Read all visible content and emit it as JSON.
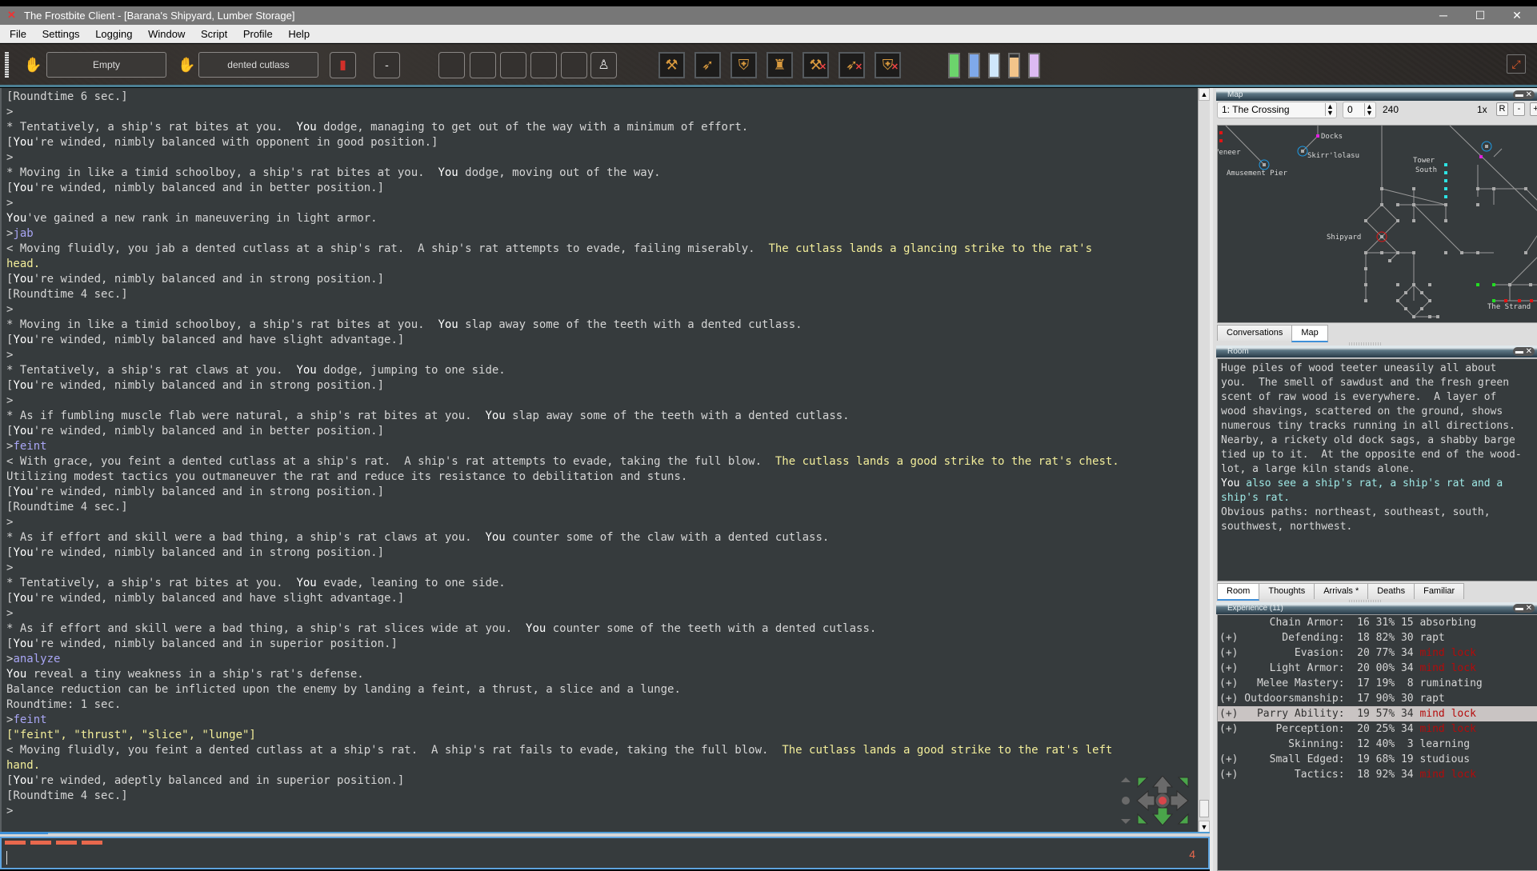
{
  "window": {
    "title": "The Frostbite Client - [Barana's Shipyard, Lumber Storage]",
    "app_icon": "frostbite-x-icon",
    "controls": {
      "minimize": "─",
      "maximize": "☐",
      "close": "✕"
    }
  },
  "menu": [
    "File",
    "Settings",
    "Logging",
    "Window",
    "Script",
    "Profile",
    "Help"
  ],
  "toolbar": {
    "left_hand_icon": "hand-icon",
    "left_hand": "Empty",
    "right_hand_icon": "hand-icon",
    "right_hand": "dented cutlass",
    "spell_icon": "spellbook-icon",
    "spell": "-",
    "status_slots": [
      "",
      "",
      "",
      "",
      ""
    ],
    "stance_icon": "standing-figure-icon",
    "wield_icons": [
      {
        "name": "melee-weapon-icon",
        "glyph": "⚒",
        "crossed": false
      },
      {
        "name": "bow-icon",
        "glyph": "➶",
        "crossed": false
      },
      {
        "name": "shield-icon",
        "glyph": "⛨",
        "crossed": false
      },
      {
        "name": "armor-icon",
        "glyph": "♜",
        "crossed": false
      },
      {
        "name": "melee-weapon-icon",
        "glyph": "⚒",
        "crossed": true
      },
      {
        "name": "bow-icon",
        "glyph": "➶",
        "crossed": true
      },
      {
        "name": "shield-icon",
        "glyph": "⛨",
        "crossed": true
      }
    ],
    "vitals": [
      {
        "name": "health",
        "color": "#6cd46c",
        "value": 100
      },
      {
        "name": "mana",
        "color": "#7fa9ea",
        "value": 100
      },
      {
        "name": "concentration",
        "color": "#cfe7fb",
        "value": 100
      },
      {
        "name": "fatigue",
        "color": "#f2c48a",
        "value": 85
      },
      {
        "name": "spirit",
        "color": "#dcbaf2",
        "value": 100
      }
    ],
    "fullscreen_icon": "⤢"
  },
  "game_log": [
    [
      {
        "t": "[Roundtime 6 sec.]"
      }
    ],
    [
      {
        "t": ">"
      }
    ],
    [
      {
        "t": "* Tentatively, a ship's rat bites at you.  "
      },
      {
        "t": "You",
        "c": "you"
      },
      {
        "t": " dodge, managing to get out of the way with a minimum of effort."
      }
    ],
    [
      {
        "t": "["
      },
      {
        "t": "You",
        "c": "you"
      },
      {
        "t": "'re winded, nimbly balanced with opponent in good position.]"
      }
    ],
    [
      {
        "t": ">"
      }
    ],
    [
      {
        "t": "* Moving in like a timid schoolboy, a ship's rat bites at you.  "
      },
      {
        "t": "You",
        "c": "you"
      },
      {
        "t": " dodge, moving out of the way."
      }
    ],
    [
      {
        "t": "["
      },
      {
        "t": "You",
        "c": "you"
      },
      {
        "t": "'re winded, nimbly balanced and in better position.]"
      }
    ],
    [
      {
        "t": ">"
      }
    ],
    [
      {
        "t": "You",
        "c": "you"
      },
      {
        "t": "'ve gained a new rank in maneuvering in light armor."
      }
    ],
    [
      {
        "t": ">"
      },
      {
        "t": "jab",
        "c": "cmd"
      }
    ],
    [
      {
        "t": "< Moving fluidly, you jab a dented cutlass at a ship's rat.  A ship's rat attempts to evade, failing miserably.  "
      },
      {
        "t": "The cutlass lands a glancing strike to the rat's",
        "c": "strike"
      }
    ],
    [
      {
        "t": "head.",
        "c": "strike"
      }
    ],
    [
      {
        "t": "["
      },
      {
        "t": "You",
        "c": "you"
      },
      {
        "t": "'re winded, nimbly balanced and in strong position.]"
      }
    ],
    [
      {
        "t": "[Roundtime 4 sec.]"
      }
    ],
    [
      {
        "t": ">"
      }
    ],
    [
      {
        "t": "* Moving in like a timid schoolboy, a ship's rat bites at you.  "
      },
      {
        "t": "You",
        "c": "you"
      },
      {
        "t": " slap away some of the teeth with a dented cutlass."
      }
    ],
    [
      {
        "t": "["
      },
      {
        "t": "You",
        "c": "you"
      },
      {
        "t": "'re winded, nimbly balanced and have slight advantage.]"
      }
    ],
    [
      {
        "t": ">"
      }
    ],
    [
      {
        "t": "* Tentatively, a ship's rat claws at you.  "
      },
      {
        "t": "You",
        "c": "you"
      },
      {
        "t": " dodge, jumping to one side."
      }
    ],
    [
      {
        "t": "["
      },
      {
        "t": "You",
        "c": "you"
      },
      {
        "t": "'re winded, nimbly balanced and in strong position.]"
      }
    ],
    [
      {
        "t": ">"
      }
    ],
    [
      {
        "t": "* As if fumbling muscle flab were natural, a ship's rat bites at you.  "
      },
      {
        "t": "You",
        "c": "you"
      },
      {
        "t": " slap away some of the teeth with a dented cutlass."
      }
    ],
    [
      {
        "t": "["
      },
      {
        "t": "You",
        "c": "you"
      },
      {
        "t": "'re winded, nimbly balanced and in better position.]"
      }
    ],
    [
      {
        "t": ">"
      },
      {
        "t": "feint",
        "c": "cmd"
      }
    ],
    [
      {
        "t": "< With grace, you feint a dented cutlass at a ship's rat.  A ship's rat attempts to evade, taking the full blow.  "
      },
      {
        "t": "The cutlass lands a good strike to the rat's chest.",
        "c": "strike"
      }
    ],
    [
      {
        "t": "Utilizing modest tactics you outmaneuver the rat and reduce its resistance to debilitation and stuns."
      }
    ],
    [
      {
        "t": "["
      },
      {
        "t": "You",
        "c": "you"
      },
      {
        "t": "'re winded, nimbly balanced and in strong position.]"
      }
    ],
    [
      {
        "t": "[Roundtime 4 sec.]"
      }
    ],
    [
      {
        "t": ">"
      }
    ],
    [
      {
        "t": "* As if effort and skill were a bad thing, a ship's rat claws at you.  "
      },
      {
        "t": "You",
        "c": "you"
      },
      {
        "t": " counter some of the claw with a dented cutlass."
      }
    ],
    [
      {
        "t": "["
      },
      {
        "t": "You",
        "c": "you"
      },
      {
        "t": "'re winded, nimbly balanced and in strong position.]"
      }
    ],
    [
      {
        "t": ">"
      }
    ],
    [
      {
        "t": "* Tentatively, a ship's rat bites at you.  "
      },
      {
        "t": "You",
        "c": "you"
      },
      {
        "t": " evade, leaning to one side."
      }
    ],
    [
      {
        "t": "["
      },
      {
        "t": "You",
        "c": "you"
      },
      {
        "t": "'re winded, nimbly balanced and have slight advantage.]"
      }
    ],
    [
      {
        "t": ">"
      }
    ],
    [
      {
        "t": "* As if effort and skill were a bad thing, a ship's rat slices wide at you.  "
      },
      {
        "t": "You",
        "c": "you"
      },
      {
        "t": " counter some of the teeth with a dented cutlass."
      }
    ],
    [
      {
        "t": "["
      },
      {
        "t": "You",
        "c": "you"
      },
      {
        "t": "'re winded, nimbly balanced and in superior position.]"
      }
    ],
    [
      {
        "t": ">"
      },
      {
        "t": "analyze",
        "c": "cmd"
      }
    ],
    [
      {
        "t": "You",
        "c": "you"
      },
      {
        "t": " reveal a tiny weakness in a ship's rat's defense."
      }
    ],
    [
      {
        "t": "Balance reduction can be inflicted upon the enemy by landing a feint, a thrust, a slice and a lunge."
      }
    ],
    [
      {
        "t": "Roundtime: 1 sec."
      }
    ],
    [
      {
        "t": ">"
      },
      {
        "t": "feint",
        "c": "cmd"
      }
    ],
    [
      {
        "t": "[\"feint\", \"thrust\", \"slice\", \"lunge\"]",
        "c": "strike"
      }
    ],
    [
      {
        "t": "< Moving fluidly, you feint a dented cutlass at a ship's rat.  A ship's rat fails to evade, taking the full blow.  "
      },
      {
        "t": "The cutlass lands a good strike to the rat's left",
        "c": "strike"
      }
    ],
    [
      {
        "t": "hand.",
        "c": "strike"
      }
    ],
    [
      {
        "t": "["
      },
      {
        "t": "You",
        "c": "you"
      },
      {
        "t": "'re winded, adeptly balanced and in superior position.]"
      }
    ],
    [
      {
        "t": "[Roundtime 4 sec.]"
      }
    ],
    [
      {
        "t": ">"
      }
    ]
  ],
  "compass": {
    "available": [
      "northeast",
      "southeast",
      "south",
      "southwest",
      "northwest"
    ],
    "colors": {
      "on": "#4aa54a",
      "off": "#6a6a6a"
    }
  },
  "command_input": {
    "value": "",
    "roundtime_marks": 4,
    "roundtime_count": "4"
  },
  "map_panel": {
    "title": "Map",
    "zone_select": "1: The Crossing",
    "level_select": "0",
    "room_id": "240",
    "zoom_label": "1x",
    "reset_btn": "R",
    "zoom_out_btn": "-",
    "zoom_in_btn": "+",
    "labels": [
      "Docks",
      "Skirr'lolasu",
      "Veneer",
      "Amusement Pier",
      "Tower",
      "South",
      "Shipyard",
      "The Strand"
    ],
    "tabs": [
      "Conversations",
      "Map"
    ],
    "active_tab": "Map"
  },
  "room_panel": {
    "title": "Room",
    "description": "Huge piles of wood teeter uneasily all about\nyou.  The smell of sawdust and the fresh green\nscent of raw wood is everywhere.  A layer of\nwood shavings, scattered on the ground, shows\nnumerous tiny tracks running in all directions.\nNearby, a rickety old dock sags, a shabby barge\ntied up to it.  At the opposite end of the wood-\nlot, a large kiln stands alone.",
    "objects_prefix": "You",
    "objects": " also see a ship's rat, a ship's rat and a\nship's rat.",
    "paths": "Obvious paths: northeast, southeast, south,\nsouthwest, northwest.",
    "tabs": [
      "Room",
      "Thoughts",
      "Arrivals *",
      "Deaths",
      "Familiar"
    ],
    "active_tab": "Room"
  },
  "experience_panel": {
    "title": "Experience (11)",
    "rows": [
      {
        "pulse": "",
        "skill": "Chain Armor",
        "rank": "16",
        "pct": "31%",
        "mind": "15",
        "state": "absorbing",
        "locked": false,
        "selected": false
      },
      {
        "pulse": "(+)",
        "skill": "Defending",
        "rank": "18",
        "pct": "82%",
        "mind": "30",
        "state": "rapt",
        "locked": false,
        "selected": false
      },
      {
        "pulse": "(+)",
        "skill": "Evasion",
        "rank": "20",
        "pct": "77%",
        "mind": "34",
        "state": "mind lock",
        "locked": true,
        "selected": false
      },
      {
        "pulse": "(+)",
        "skill": "Light Armor",
        "rank": "20",
        "pct": "00%",
        "mind": "34",
        "state": "mind lock",
        "locked": true,
        "selected": false
      },
      {
        "pulse": "(+)",
        "skill": "Melee Mastery",
        "rank": "17",
        "pct": "19%",
        "mind": " 8",
        "state": "ruminating",
        "locked": false,
        "selected": false
      },
      {
        "pulse": "(+)",
        "skill": "Outdoorsmanship",
        "rank": "17",
        "pct": "90%",
        "mind": "30",
        "state": "rapt",
        "locked": false,
        "selected": false
      },
      {
        "pulse": "(+)",
        "skill": "Parry Ability",
        "rank": "19",
        "pct": "57%",
        "mind": "34",
        "state": "mind lock",
        "locked": true,
        "selected": true
      },
      {
        "pulse": "(+)",
        "skill": "Perception",
        "rank": "20",
        "pct": "25%",
        "mind": "34",
        "state": "mind lock",
        "locked": true,
        "selected": false
      },
      {
        "pulse": "",
        "skill": "Skinning",
        "rank": "12",
        "pct": "40%",
        "mind": " 3",
        "state": "learning",
        "locked": false,
        "selected": false
      },
      {
        "pulse": "(+)",
        "skill": "Small Edged",
        "rank": "19",
        "pct": "68%",
        "mind": "19",
        "state": "studious",
        "locked": false,
        "selected": false
      },
      {
        "pulse": "(+)",
        "skill": "Tactics",
        "rank": "18",
        "pct": "92%",
        "mind": "34",
        "state": "mind lock",
        "locked": true,
        "selected": false
      }
    ]
  },
  "dock_controls": {
    "minimize": "▬",
    "close": "✕"
  }
}
